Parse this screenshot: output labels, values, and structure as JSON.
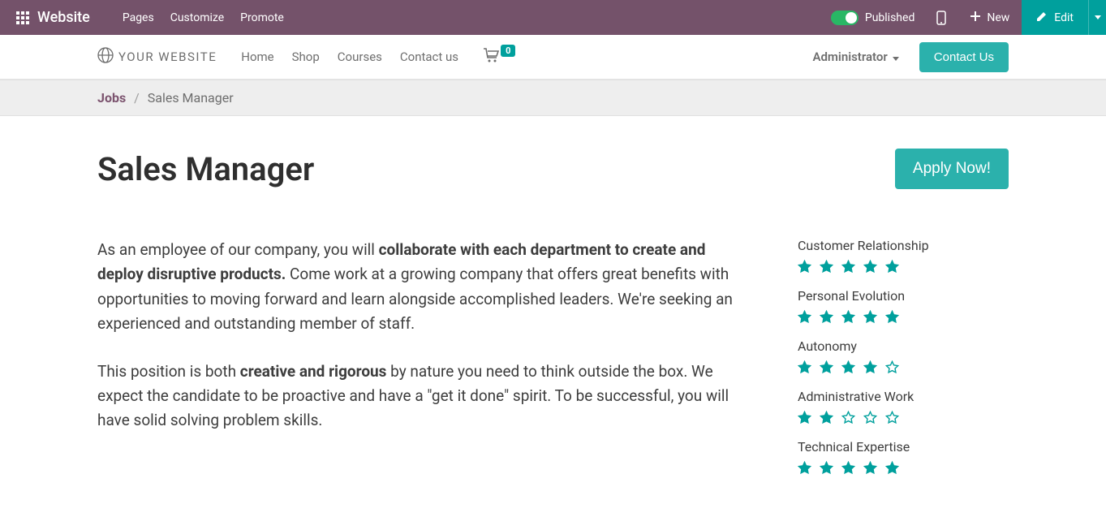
{
  "topbar": {
    "brand": "Website",
    "menu": [
      "Pages",
      "Customize",
      "Promote"
    ],
    "published_label": "Published",
    "new_label": "New",
    "edit_label": "Edit"
  },
  "site_header": {
    "logo_text": "YOUR WEBSITE",
    "nav": [
      "Home",
      "Shop",
      "Courses",
      "Contact us"
    ],
    "cart_count": "0",
    "admin_label": "Administrator",
    "contact_btn": "Contact Us"
  },
  "breadcrumb": {
    "root": "Jobs",
    "sep": "/",
    "current": "Sales Manager"
  },
  "page": {
    "title": "Sales Manager",
    "apply_btn": "Apply Now!",
    "para1_lead": "As an employee of our company, you will ",
    "para1_bold": "collaborate with each department to create and deploy disruptive products.",
    "para1_tail": " Come work at a growing company that offers great benefits with opportunities to moving forward and learn alongside accomplished leaders. We're seeking an experienced and outstanding member of staff.",
    "para2_lead": "This position is both ",
    "para2_bold": "creative and rigorous",
    "para2_tail": " by nature you need to think outside the box. We expect the candidate to be proactive and have a \"get it done\" spirit. To be successful, you will have solid solving problem skills."
  },
  "skills": [
    {
      "label": "Customer Relationship",
      "rating": 5
    },
    {
      "label": "Personal Evolution",
      "rating": 5
    },
    {
      "label": "Autonomy",
      "rating": 4
    },
    {
      "label": "Administrative Work",
      "rating": 2
    },
    {
      "label": "Technical Expertise",
      "rating": 5
    }
  ],
  "colors": {
    "teal": "#00a09d",
    "mauve": "#74526a"
  }
}
